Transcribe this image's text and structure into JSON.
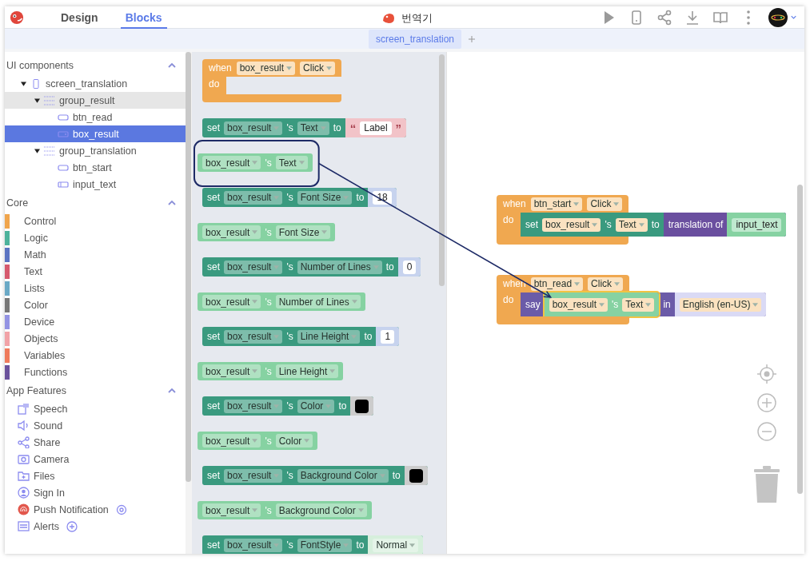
{
  "header": {
    "tabs": [
      {
        "label": "Design",
        "selected": false
      },
      {
        "label": "Blocks",
        "selected": true
      }
    ],
    "project_title": "번역기"
  },
  "screen_tabs": [
    {
      "label": "screen_translation",
      "selected": true
    }
  ],
  "sidebar": {
    "components": {
      "title": "UI components",
      "expanded": true,
      "tree": [
        {
          "label": "screen_translation",
          "kind": "screen",
          "expanded": true,
          "selected": false,
          "hovered": false,
          "children": [
            {
              "label": "group_result",
              "kind": "group",
              "expanded": true,
              "selected": false,
              "hovered": true,
              "children": [
                {
                  "label": "btn_read",
                  "kind": "button",
                  "selected": false,
                  "hovered": false
                },
                {
                  "label": "box_result",
                  "kind": "label",
                  "selected": true,
                  "hovered": false
                }
              ]
            },
            {
              "label": "group_translation",
              "kind": "group",
              "expanded": true,
              "selected": false,
              "hovered": false,
              "children": [
                {
                  "label": "btn_start",
                  "kind": "button",
                  "selected": false,
                  "hovered": false
                },
                {
                  "label": "input_text",
                  "kind": "input",
                  "selected": false,
                  "hovered": false
                }
              ]
            }
          ]
        }
      ]
    },
    "core": {
      "title": "Core",
      "expanded": true,
      "items": [
        {
          "label": "Control",
          "color": "#f0a54c"
        },
        {
          "label": "Logic",
          "color": "#4db39c"
        },
        {
          "label": "Math",
          "color": "#5b74c2"
        },
        {
          "label": "Text",
          "color": "#d6596d"
        },
        {
          "label": "Lists",
          "color": "#6aa9c6"
        },
        {
          "label": "Color",
          "color": "#777777"
        },
        {
          "label": "Device",
          "color": "#9393e3"
        },
        {
          "label": "Objects",
          "color": "#f2a3a7"
        },
        {
          "label": "Variables",
          "color": "#ef7b5c"
        },
        {
          "label": "Functions",
          "color": "#6b529c"
        }
      ]
    },
    "features": {
      "title": "App Features",
      "expanded": true,
      "items": [
        {
          "label": "Speech",
          "kind": "plain"
        },
        {
          "label": "Sound",
          "kind": "plain"
        },
        {
          "label": "Share",
          "kind": "plain"
        },
        {
          "label": "Camera",
          "kind": "plain"
        },
        {
          "label": "Files",
          "kind": "plain"
        },
        {
          "label": "Sign In",
          "kind": "plain"
        },
        {
          "label": "Push Notification",
          "kind": "settings"
        },
        {
          "label": "Alerts",
          "kind": "add"
        }
      ]
    }
  },
  "palette": {
    "blocks": [
      {
        "kind": "event",
        "parts": [
          {
            "kind": "word",
            "text": "when"
          },
          {
            "kind": "dropdown",
            "text": "box_result"
          },
          {
            "kind": "dropdown",
            "text": "Click"
          }
        ],
        "do": "do"
      },
      {
        "kind": "setter",
        "parts": [
          {
            "kind": "word",
            "text": "set"
          },
          {
            "kind": "dropdown",
            "text": "box_result"
          },
          {
            "kind": "word",
            "text": "'s"
          },
          {
            "kind": "dropdown",
            "text": "Text"
          },
          {
            "kind": "word",
            "text": "to"
          },
          {
            "kind": "block",
            "block": {
              "kind": "text",
              "parts": [
                {
                  "kind": "word",
                  "text": "“"
                },
                {
                  "kind": "field",
                  "text": "Label"
                },
                {
                  "kind": "word",
                  "text": "”"
                }
              ]
            }
          }
        ]
      },
      {
        "kind": "getter",
        "annotated": true,
        "parts": [
          {
            "kind": "dropdown",
            "text": "box_result"
          },
          {
            "kind": "word",
            "text": "'s"
          },
          {
            "kind": "dropdown",
            "text": "Text"
          }
        ]
      },
      {
        "kind": "setter",
        "parts": [
          {
            "kind": "word",
            "text": "set"
          },
          {
            "kind": "dropdown",
            "text": "box_result"
          },
          {
            "kind": "word",
            "text": "'s"
          },
          {
            "kind": "dropdown",
            "text": "Font Size"
          },
          {
            "kind": "word",
            "text": "to"
          },
          {
            "kind": "block",
            "block": {
              "kind": "number",
              "parts": [
                {
                  "kind": "field",
                  "text": "18"
                }
              ]
            }
          }
        ]
      },
      {
        "kind": "getter",
        "parts": [
          {
            "kind": "dropdown",
            "text": "box_result"
          },
          {
            "kind": "word",
            "text": "'s"
          },
          {
            "kind": "dropdown",
            "text": "Font Size"
          }
        ]
      },
      {
        "kind": "setter",
        "parts": [
          {
            "kind": "word",
            "text": "set"
          },
          {
            "kind": "dropdown",
            "text": "box_result"
          },
          {
            "kind": "word",
            "text": "'s"
          },
          {
            "kind": "dropdown",
            "text": "Number of Lines"
          },
          {
            "kind": "word",
            "text": "to"
          },
          {
            "kind": "block",
            "block": {
              "kind": "number",
              "parts": [
                {
                  "kind": "field",
                  "text": "0"
                }
              ]
            }
          }
        ]
      },
      {
        "kind": "getter",
        "parts": [
          {
            "kind": "dropdown",
            "text": "box_result"
          },
          {
            "kind": "word",
            "text": "'s"
          },
          {
            "kind": "dropdown",
            "text": "Number of Lines"
          }
        ]
      },
      {
        "kind": "setter",
        "parts": [
          {
            "kind": "word",
            "text": "set"
          },
          {
            "kind": "dropdown",
            "text": "box_result"
          },
          {
            "kind": "word",
            "text": "'s"
          },
          {
            "kind": "dropdown",
            "text": "Line Height"
          },
          {
            "kind": "word",
            "text": "to"
          },
          {
            "kind": "block",
            "block": {
              "kind": "number",
              "parts": [
                {
                  "kind": "field",
                  "text": "1"
                }
              ]
            }
          }
        ]
      },
      {
        "kind": "getter",
        "parts": [
          {
            "kind": "dropdown",
            "text": "box_result"
          },
          {
            "kind": "word",
            "text": "'s"
          },
          {
            "kind": "dropdown",
            "text": "Line Height"
          }
        ]
      },
      {
        "kind": "setter",
        "parts": [
          {
            "kind": "word",
            "text": "set"
          },
          {
            "kind": "dropdown",
            "text": "box_result"
          },
          {
            "kind": "word",
            "text": "'s"
          },
          {
            "kind": "dropdown",
            "text": "Color"
          },
          {
            "kind": "word",
            "text": "to"
          },
          {
            "kind": "block",
            "block": {
              "kind": "color",
              "parts": [
                {
                  "kind": "swatch",
                  "color": "#000000"
                }
              ]
            }
          }
        ]
      },
      {
        "kind": "getter",
        "parts": [
          {
            "kind": "dropdown",
            "text": "box_result"
          },
          {
            "kind": "word",
            "text": "'s"
          },
          {
            "kind": "dropdown",
            "text": "Color"
          }
        ]
      },
      {
        "kind": "setter",
        "parts": [
          {
            "kind": "word",
            "text": "set"
          },
          {
            "kind": "dropdown",
            "text": "box_result"
          },
          {
            "kind": "word",
            "text": "'s"
          },
          {
            "kind": "dropdown",
            "text": "Background Color"
          },
          {
            "kind": "word",
            "text": "to"
          },
          {
            "kind": "block",
            "block": {
              "kind": "color",
              "parts": [
                {
                  "kind": "swatch",
                  "color": "#000000"
                }
              ]
            }
          }
        ]
      },
      {
        "kind": "getter",
        "parts": [
          {
            "kind": "dropdown",
            "text": "box_result"
          },
          {
            "kind": "word",
            "text": "'s"
          },
          {
            "kind": "dropdown",
            "text": "Background Color"
          }
        ]
      },
      {
        "kind": "setter",
        "parts": [
          {
            "kind": "word",
            "text": "set"
          },
          {
            "kind": "dropdown",
            "text": "box_result"
          },
          {
            "kind": "word",
            "text": "'s"
          },
          {
            "kind": "dropdown",
            "text": "FontStyle"
          },
          {
            "kind": "word",
            "text": "to"
          },
          {
            "kind": "block",
            "block": {
              "kind": "option",
              "parts": [
                {
                  "kind": "dropdown",
                  "text": "Normal"
                }
              ]
            }
          }
        ]
      }
    ]
  },
  "workspace": {
    "blocks": [
      {
        "kind": "event",
        "parts": [
          {
            "kind": "word",
            "text": "when"
          },
          {
            "kind": "dropdown",
            "text": "btn_start"
          },
          {
            "kind": "dropdown",
            "text": "Click"
          }
        ],
        "do": "do",
        "body": [
          {
            "kind": "setter",
            "parts": [
              {
                "kind": "word",
                "text": "set"
              },
              {
                "kind": "dropdown",
                "text": "box_result"
              },
              {
                "kind": "word",
                "text": "'s"
              },
              {
                "kind": "dropdown",
                "text": "Text"
              },
              {
                "kind": "word",
                "text": "to"
              },
              {
                "kind": "block",
                "block": {
                  "kind": "translate",
                  "parts": [
                    {
                      "kind": "word",
                      "text": "translation of"
                    },
                    {
                      "kind": "block",
                      "block": {
                        "kind": "getter",
                        "parts": [
                          {
                            "kind": "field",
                            "text": "input_text"
                          }
                        ]
                      }
                    }
                  ]
                }
              }
            ]
          }
        ]
      },
      {
        "kind": "event",
        "parts": [
          {
            "kind": "word",
            "text": "when"
          },
          {
            "kind": "dropdown",
            "text": "btn_read"
          },
          {
            "kind": "dropdown",
            "text": "Click"
          }
        ],
        "do": "do",
        "body": [
          {
            "kind": "say",
            "parts": [
              {
                "kind": "word",
                "text": "say"
              },
              {
                "kind": "block",
                "block": {
                  "kind": "getter",
                  "selected": true,
                  "parts": [
                    {
                      "kind": "dropdown",
                      "text": "box_result"
                    },
                    {
                      "kind": "word",
                      "text": "'s"
                    },
                    {
                      "kind": "dropdown",
                      "text": "Text"
                    }
                  ]
                }
              },
              {
                "kind": "word",
                "text": "in"
              },
              {
                "kind": "block",
                "block": {
                  "kind": "language",
                  "parts": [
                    {
                      "kind": "dropdown",
                      "text": "English (en-US)"
                    }
                  ]
                }
              }
            ]
          }
        ]
      }
    ]
  }
}
